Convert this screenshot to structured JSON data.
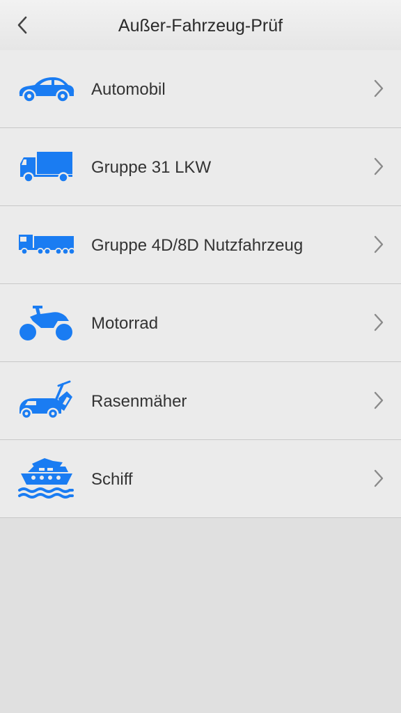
{
  "header": {
    "title": "Außer-Fahrzeug-Prüf",
    "back_icon": "chevron-left-icon"
  },
  "colors": {
    "accent": "#1a7cf2",
    "header_bg": "#eeeeee",
    "list_bg": "#ebebeb",
    "page_bg": "#e0e0e0",
    "text": "#333333",
    "chevron": "#8a8a8a"
  },
  "items": [
    {
      "label": "Automobil",
      "icon": "car-icon"
    },
    {
      "label": "Gruppe 31 LKW",
      "icon": "truck-icon"
    },
    {
      "label": "Gruppe 4D/8D Nutzfahrzeug",
      "icon": "semi-truck-icon"
    },
    {
      "label": "Motorrad",
      "icon": "motorcycle-icon"
    },
    {
      "label": "Rasenmäher",
      "icon": "lawn-mower-icon"
    },
    {
      "label": "Schiff",
      "icon": "ship-icon"
    }
  ]
}
